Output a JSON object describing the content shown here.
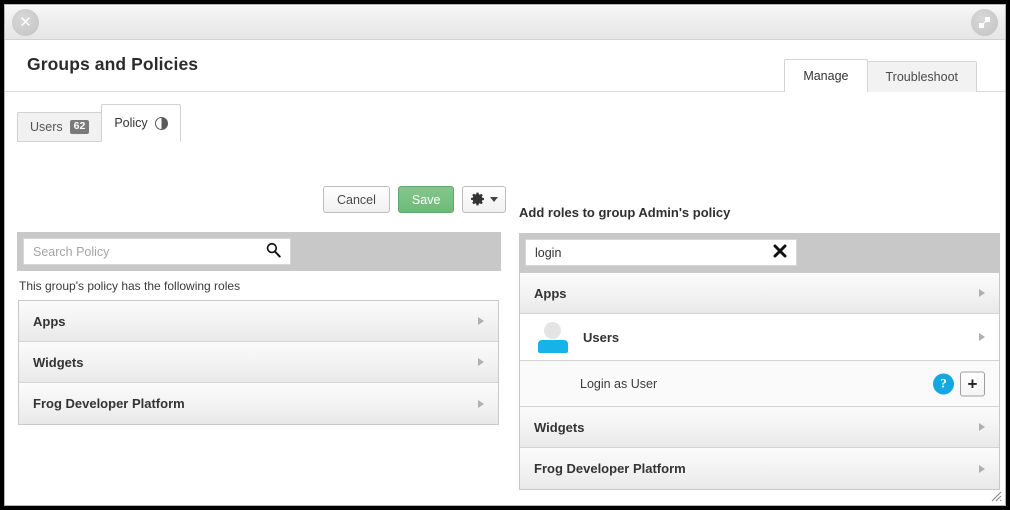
{
  "window": {
    "close_icon": "close-icon",
    "expand_icon": "expand-restore-icon"
  },
  "header": {
    "title": "Groups and Policies",
    "tabs": [
      {
        "label": "Manage",
        "active": true
      },
      {
        "label": "Troubleshoot",
        "active": false
      }
    ]
  },
  "left_panel": {
    "subtabs": [
      {
        "label": "Users",
        "badge": "62",
        "active": false
      },
      {
        "label": "Policy",
        "icon": "half-circle-icon",
        "active": true
      }
    ],
    "actions": {
      "cancel_label": "Cancel",
      "save_label": "Save",
      "gear_icon": "gear-icon",
      "caret_icon": "chevron-down-icon"
    },
    "search": {
      "placeholder": "Search Policy",
      "value": "",
      "icon": "search-icon"
    },
    "hint": "This group's policy has the following roles",
    "roles": [
      {
        "label": "Apps"
      },
      {
        "label": "Widgets"
      },
      {
        "label": "Frog Developer Platform"
      }
    ]
  },
  "right_panel": {
    "title": "Add roles to group Admin's policy",
    "search": {
      "placeholder": "",
      "value": "login",
      "clear_icon": "clear-x-icon"
    },
    "groups": [
      {
        "label": "Apps",
        "type": "group"
      },
      {
        "label": "Users",
        "type": "group-user",
        "icon": "user-avatar-icon"
      },
      {
        "label": "Login as User",
        "type": "role",
        "help": "?",
        "add": "+"
      },
      {
        "label": "Widgets",
        "type": "group"
      },
      {
        "label": "Frog Developer Platform",
        "type": "group"
      }
    ]
  },
  "colors": {
    "save_green": "#6fb97a",
    "accent_blue": "#14a7e0",
    "avatar_blue": "#16b3e8",
    "strip_gray": "#c8c8c8"
  }
}
